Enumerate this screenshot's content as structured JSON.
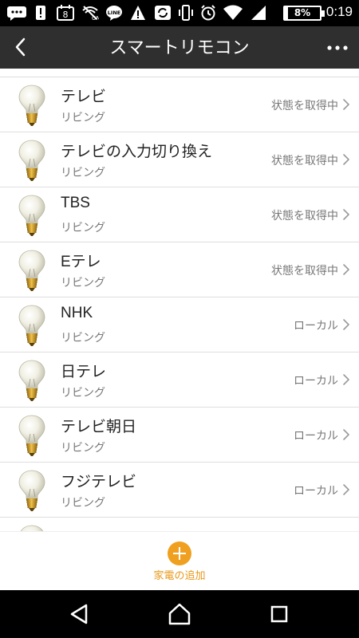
{
  "status_bar": {
    "time": "0:19",
    "battery_text": "8%",
    "battery_level": 0.08,
    "icons": [
      "chat-bubble-icon",
      "alert-icon",
      "calendar-8-icon",
      "wifi-off-icon",
      "line-icon",
      "warning-icon",
      "sync-icon",
      "vibrate-icon",
      "alarm-icon",
      "wifi-icon",
      "signal-icon"
    ]
  },
  "app_bar": {
    "title": "スマートリモコン",
    "back_icon": "chevron-left-icon",
    "more_icon": "more-horizontal-icon"
  },
  "devices": [
    {
      "name": "テレビ",
      "room": "リビング",
      "status": "状態を取得中"
    },
    {
      "name": "テレビの入力切り換え",
      "room": "リビング",
      "status": "状態を取得中"
    },
    {
      "name": "TBS",
      "room": "リビング",
      "status": "状態を取得中"
    },
    {
      "name": "Eテレ",
      "room": "リビング",
      "status": "状態を取得中"
    },
    {
      "name": "NHK",
      "room": "リビング",
      "status": "ローカル"
    },
    {
      "name": "日テレ",
      "room": "リビング",
      "status": "ローカル"
    },
    {
      "name": "テレビ朝日",
      "room": "リビング",
      "status": "ローカル"
    },
    {
      "name": "フジテレビ",
      "room": "リビング",
      "status": "ローカル"
    }
  ],
  "add_button": {
    "label": "家電の追加",
    "icon": "plus-circle-icon"
  },
  "colors": {
    "app_bar": "#2f2f2f",
    "accent": "#f0a020",
    "divider": "#dedede"
  },
  "nav_bar": {
    "icons": [
      "back-triangle-icon",
      "home-icon",
      "recents-square-icon"
    ]
  }
}
